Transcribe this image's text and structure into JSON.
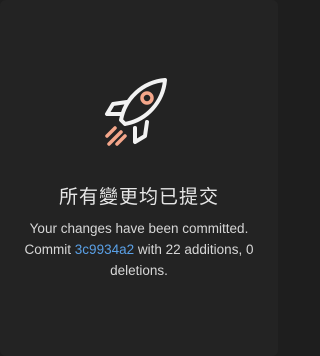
{
  "colors": {
    "background": "#232323",
    "rocket_outline": "#f2f2f2",
    "rocket_window": "#f4a68a",
    "rocket_trail": "#f4a68a",
    "link": "#5aa0e6",
    "text": "#d6d6d6"
  },
  "icon": "rocket-icon",
  "title": "所有變更均已提交",
  "message": {
    "line1": "Your changes have been committed.",
    "prefix": "Commit",
    "hash": "3c9934a2",
    "suffix": "with 22 additions, 0 deletions."
  }
}
